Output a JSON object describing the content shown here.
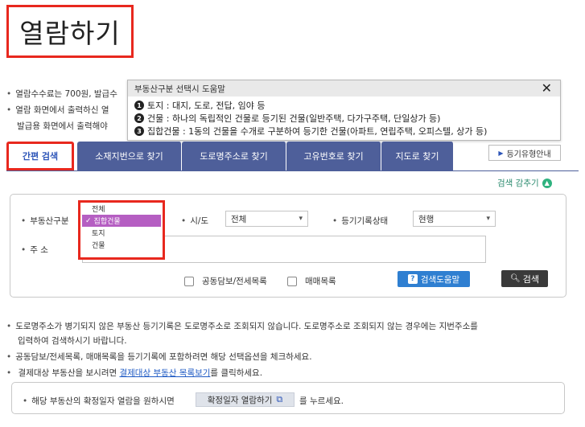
{
  "title": "열람하기",
  "info_lines": [
    "열람수수료는 700원, 발급수",
    "열람 화면에서 출력하신 열",
    "발급용 화면에서 출력해야"
  ],
  "tooltip": {
    "header": "부동산구분 선택시 도움말",
    "close": "✕",
    "rows": [
      {
        "num": "1",
        "text": "토지 : 대지, 도로, 전답, 임야 등"
      },
      {
        "num": "2",
        "text": "건물 : 하나의 독립적인 건물로 등기된 건물(일반주택, 다가구주택, 단일상가 등)"
      },
      {
        "num": "3",
        "text": "집합건물 : 1동의 건물을 수개로 구분하여 등기한 건물(아파트, 연립주택, 오피스텔, 상가 등)"
      }
    ]
  },
  "tabs": [
    {
      "label": "간편 검색"
    },
    {
      "label": "소재지번으로 찾기"
    },
    {
      "label": "도로명주소로 찾기"
    },
    {
      "label": "고유번호로 찾기"
    },
    {
      "label": "지도로 찾기"
    }
  ],
  "guide_button": "등기유형안내",
  "collapse_label": "검색 감추기",
  "form": {
    "property_label": "부동산구분",
    "property_options": [
      "전체",
      "집합건물",
      "토지",
      "건물"
    ],
    "property_selected": "집합건물",
    "region_label": "시/도",
    "region_value": "전체",
    "status_label": "등기기록상태",
    "status_value": "현행",
    "address_label": "주 소",
    "check1": "공동담보/전세목록",
    "check2": "매매목록",
    "help_btn": "검색도움말",
    "search_btn": "검색"
  },
  "notes": {
    "line1": "도로명주소가 병기되지 않은 부동산 등기기록은 도로명주소로 조회되지 않습니다. 도로명주소로 조회되지 않는 경우에는 지번주소를",
    "line1b": "입력하여 검색하시기 바랍니다.",
    "line2": "공동담보/전세목록, 매매목록을 등기기록에 포함하려면 해당 선택옵션을 체크하세요.",
    "line3_pre": "결제대상 부동산을 보시려면 ",
    "line3_link": "결제대상 부동산 목록보기",
    "line3_post": "를 클릭하세요.",
    "bottom_pre": "해당 부동산의 확정일자 열람을 원하시면",
    "bottom_btn": "확정일자 열람하기",
    "bottom_post": "를 누르세요."
  }
}
